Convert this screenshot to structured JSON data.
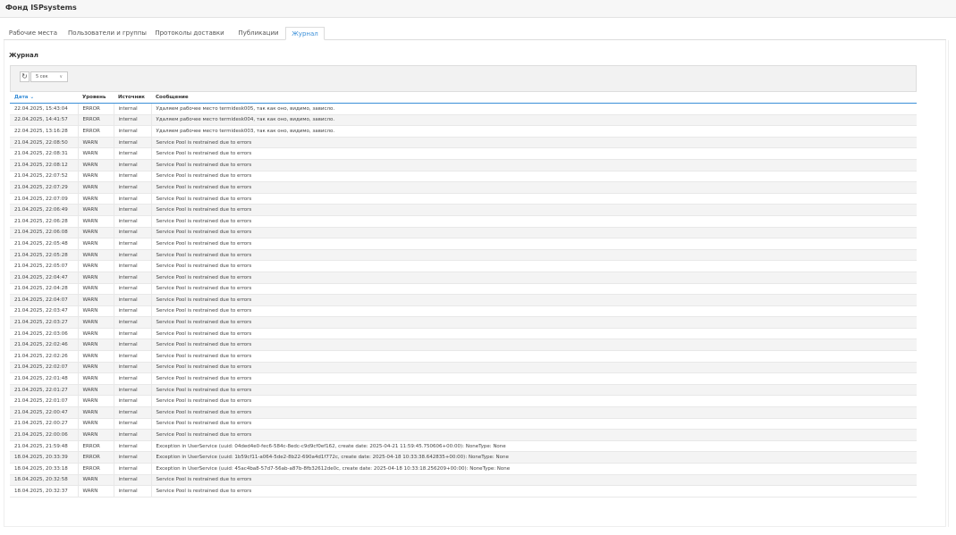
{
  "app": {
    "title": "Фонд ISPsystems"
  },
  "tabs": [
    {
      "label": "Рабочие места",
      "active": false
    },
    {
      "label": "Пользователи и группы",
      "active": false
    },
    {
      "label": "Протоколы доставки",
      "active": false
    },
    {
      "label": "Публикации",
      "active": false
    },
    {
      "label": "Журнал",
      "active": true
    }
  ],
  "panel": {
    "title": "Журнал",
    "toolbar": {
      "refresh_icon": "refresh-icon",
      "interval_value": "5 сек"
    }
  },
  "accent_color": "#3a8fd8",
  "table": {
    "columns": [
      {
        "label": "Дата",
        "sorted": true
      },
      {
        "label": "Уровень"
      },
      {
        "label": "Источник"
      },
      {
        "label": "Сообщение"
      }
    ],
    "rows": [
      [
        "22.04.2025, 15:43:04",
        "ERROR",
        "internal",
        "Удаляем рабочее место termidesk005, так как оно, видимо, зависло."
      ],
      [
        "22.04.2025, 14:41:57",
        "ERROR",
        "internal",
        "Удаляем рабочее место termidesk004, так как оно, видимо, зависло."
      ],
      [
        "22.04.2025, 13:16:28",
        "ERROR",
        "internal",
        "Удаляем рабочее место termidesk003, так как оно, видимо, зависло."
      ],
      [
        "21.04.2025, 22:08:50",
        "WARN",
        "internal",
        "Service Pool is restrained due to errors"
      ],
      [
        "21.04.2025, 22:08:31",
        "WARN",
        "internal",
        "Service Pool is restrained due to errors"
      ],
      [
        "21.04.2025, 22:08:12",
        "WARN",
        "internal",
        "Service Pool is restrained due to errors"
      ],
      [
        "21.04.2025, 22:07:52",
        "WARN",
        "internal",
        "Service Pool is restrained due to errors"
      ],
      [
        "21.04.2025, 22:07:29",
        "WARN",
        "internal",
        "Service Pool is restrained due to errors"
      ],
      [
        "21.04.2025, 22:07:09",
        "WARN",
        "internal",
        "Service Pool is restrained due to errors"
      ],
      [
        "21.04.2025, 22:06:49",
        "WARN",
        "internal",
        "Service Pool is restrained due to errors"
      ],
      [
        "21.04.2025, 22:06:28",
        "WARN",
        "internal",
        "Service Pool is restrained due to errors"
      ],
      [
        "21.04.2025, 22:06:08",
        "WARN",
        "internal",
        "Service Pool is restrained due to errors"
      ],
      [
        "21.04.2025, 22:05:48",
        "WARN",
        "internal",
        "Service Pool is restrained due to errors"
      ],
      [
        "21.04.2025, 22:05:28",
        "WARN",
        "internal",
        "Service Pool is restrained due to errors"
      ],
      [
        "21.04.2025, 22:05:07",
        "WARN",
        "internal",
        "Service Pool is restrained due to errors"
      ],
      [
        "21.04.2025, 22:04:47",
        "WARN",
        "internal",
        "Service Pool is restrained due to errors"
      ],
      [
        "21.04.2025, 22:04:28",
        "WARN",
        "internal",
        "Service Pool is restrained due to errors"
      ],
      [
        "21.04.2025, 22:04:07",
        "WARN",
        "internal",
        "Service Pool is restrained due to errors"
      ],
      [
        "21.04.2025, 22:03:47",
        "WARN",
        "internal",
        "Service Pool is restrained due to errors"
      ],
      [
        "21.04.2025, 22:03:27",
        "WARN",
        "internal",
        "Service Pool is restrained due to errors"
      ],
      [
        "21.04.2025, 22:03:06",
        "WARN",
        "internal",
        "Service Pool is restrained due to errors"
      ],
      [
        "21.04.2025, 22:02:46",
        "WARN",
        "internal",
        "Service Pool is restrained due to errors"
      ],
      [
        "21.04.2025, 22:02:26",
        "WARN",
        "internal",
        "Service Pool is restrained due to errors"
      ],
      [
        "21.04.2025, 22:02:07",
        "WARN",
        "internal",
        "Service Pool is restrained due to errors"
      ],
      [
        "21.04.2025, 22:01:48",
        "WARN",
        "internal",
        "Service Pool is restrained due to errors"
      ],
      [
        "21.04.2025, 22:01:27",
        "WARN",
        "internal",
        "Service Pool is restrained due to errors"
      ],
      [
        "21.04.2025, 22:01:07",
        "WARN",
        "internal",
        "Service Pool is restrained due to errors"
      ],
      [
        "21.04.2025, 22:00:47",
        "WARN",
        "internal",
        "Service Pool is restrained due to errors"
      ],
      [
        "21.04.2025, 22:00:27",
        "WARN",
        "internal",
        "Service Pool is restrained due to errors"
      ],
      [
        "21.04.2025, 22:00:06",
        "WARN",
        "internal",
        "Service Pool is restrained due to errors"
      ],
      [
        "21.04.2025, 21:59:48",
        "ERROR",
        "internal",
        "Exception in UserService (uuid: 04ded4e0-fec6-584c-8edc-c9d9cf0ef162, create date: 2025-04-21 11:59:45.750606+00:00): NoneType: None"
      ],
      [
        "18.04.2025, 20:33:39",
        "ERROR",
        "internal",
        "Exception in UserService (uuid: 1b59cf11-a064-5de2-8b22-690a4d1f772c, create date: 2025-04-18 10:33:38.642835+00:00): NoneType: None"
      ],
      [
        "18.04.2025, 20:33:18",
        "ERROR",
        "internal",
        "Exception in UserService (uuid: 45ac4ba8-57d7-56ab-a87b-8fb32612de0c, create date: 2025-04-18 10:33:18.256209+00:00): NoneType: None"
      ],
      [
        "18.04.2025, 20:32:58",
        "WARN",
        "internal",
        "Service Pool is restrained due to errors"
      ],
      [
        "18.04.2025, 20:32:37",
        "WARN",
        "internal",
        "Service Pool is restrained due to errors"
      ]
    ]
  }
}
